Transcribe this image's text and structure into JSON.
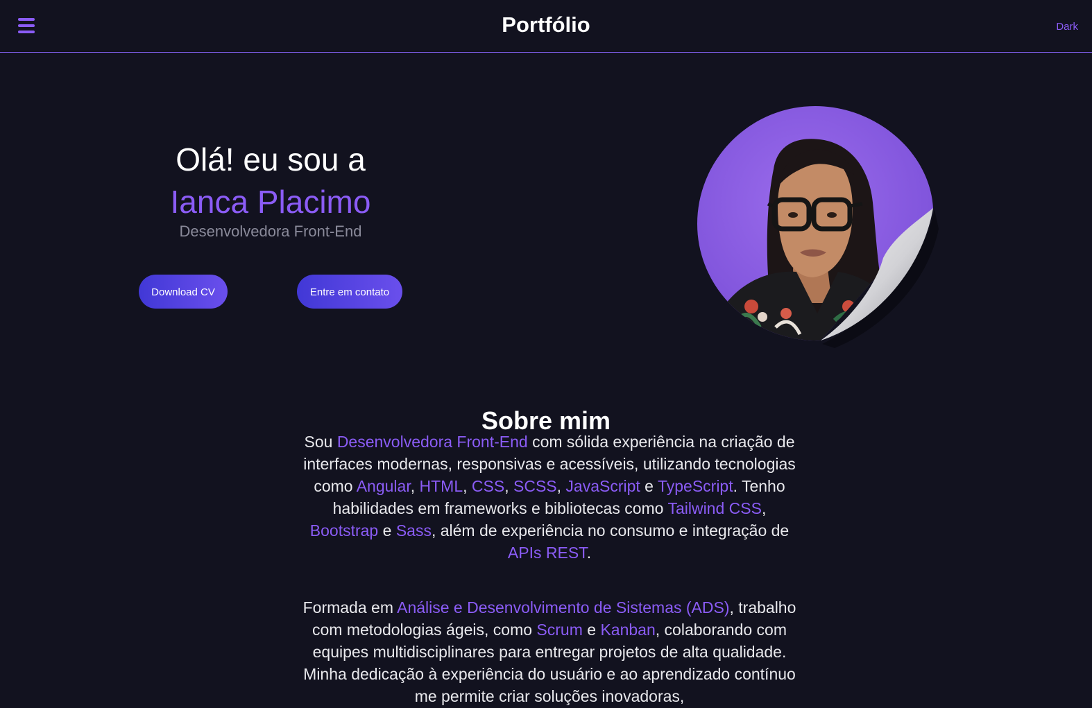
{
  "header": {
    "title": "Portfólio",
    "theme_label": "Dark",
    "menu_icon": "hamburger-menu-icon"
  },
  "hero": {
    "greeting": "Olá! eu sou a",
    "name": "Ianca Placimo",
    "role": "Desenvolvedora Front-End",
    "download_cv": "Download CV",
    "contact": "Entre em contato"
  },
  "about": {
    "title": "Sobre mim",
    "p1": {
      "t0": "Sou ",
      "h0": "Desenvolvedora Front-End",
      "t1": " com sólida experiência na criação de interfaces modernas, responsivas e acessíveis, utilizando tecnologias como ",
      "h1": "Angular",
      "t2": ", ",
      "h2": "HTML",
      "t3": ", ",
      "h3": "CSS",
      "t4": ", ",
      "h4": "SCSS",
      "t5": ", ",
      "h5": "JavaScript",
      "t6": " e ",
      "h6": "TypeScript",
      "t7": ". Tenho habilidades em frameworks e bibliotecas como ",
      "h7": "Tailwind CSS",
      "t8": ", ",
      "h8": "Bootstrap",
      "t9": " e ",
      "h9": "Sass",
      "t10": ", além de experiência no consumo e integração de ",
      "h10": "APIs REST",
      "t11": "."
    },
    "p2": {
      "t0": "Formada em ",
      "h0": "Análise e Desenvolvimento de Sistemas (ADS)",
      "t1": ", trabalho com metodologias ágeis, como ",
      "h1": "Scrum",
      "t2": " e ",
      "h2": "Kanban",
      "t3": ", colaborando com equipes multidisciplinares para entregar projetos de alta qualidade. Minha dedicação à experiência do usuário e ao aprendizado contínuo me permite criar soluções inovadoras,"
    }
  },
  "colors": {
    "background": "#12121f",
    "accent": "#8b5cf6",
    "button_gradient_start": "#4138d6",
    "button_gradient_end": "#6a4fec"
  }
}
